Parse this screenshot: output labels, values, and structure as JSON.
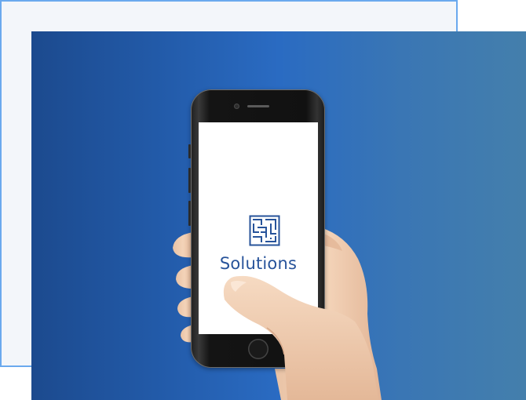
{
  "screen": {
    "app_label": "Solutions",
    "icon": "maze-icon"
  },
  "colors": {
    "frame_border": "#6aa9ee",
    "panel_gradient_start": "#1c4a8e",
    "panel_gradient_end": "#447fac",
    "label_color": "#27539a"
  }
}
